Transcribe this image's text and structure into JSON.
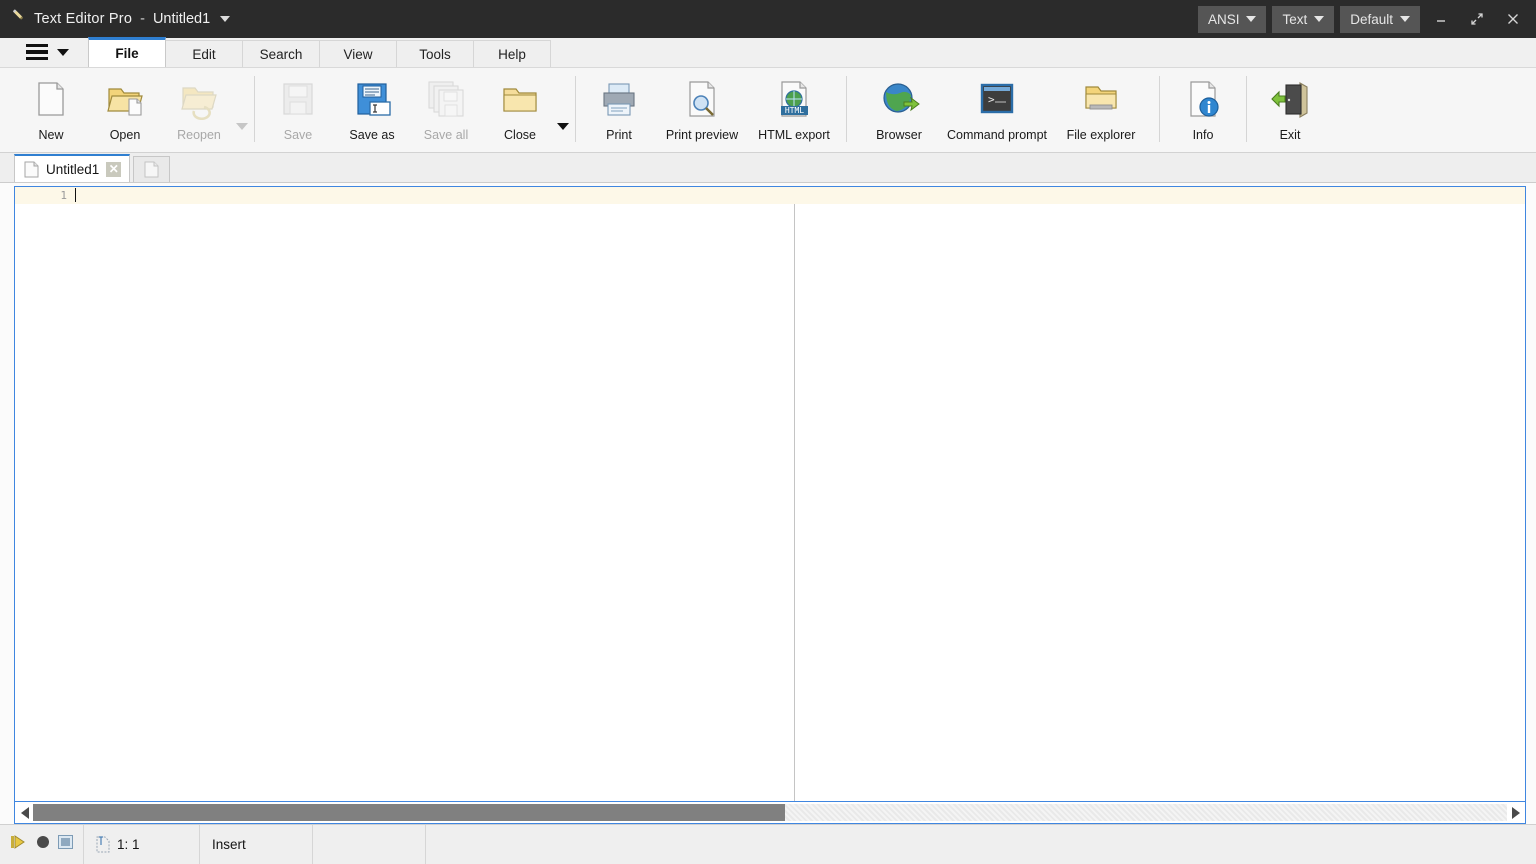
{
  "titlebar": {
    "app_icon": "pencil-icon",
    "app_name": "Text Editor Pro",
    "separator": "-",
    "document": "Untitled1",
    "doc_dropdown_icon": "chevron-down-icon",
    "pills": [
      {
        "label": "ANSI",
        "icon": "chevron-down-icon"
      },
      {
        "label": "Text",
        "icon": "chevron-down-icon"
      },
      {
        "label": "Default",
        "icon": "chevron-down-icon"
      }
    ],
    "window_controls": [
      {
        "name": "minimize-button",
        "icon": "minimize-icon"
      },
      {
        "name": "maximize-button",
        "icon": "maximize-icon"
      },
      {
        "name": "close-button",
        "icon": "close-icon"
      }
    ]
  },
  "menu": {
    "hamburger_icon": "hamburger-icon",
    "hamburger_caret_icon": "chevron-down-icon"
  },
  "ribbon_tabs": [
    {
      "label": "File",
      "active": true
    },
    {
      "label": "Edit",
      "active": false
    },
    {
      "label": "Search",
      "active": false
    },
    {
      "label": "View",
      "active": false
    },
    {
      "label": "Tools",
      "active": false
    },
    {
      "label": "Help",
      "active": false
    }
  ],
  "ribbon_buttons": {
    "new": {
      "label": "New",
      "icon": "new-document-icon",
      "enabled": true
    },
    "open": {
      "label": "Open",
      "icon": "open-folder-icon",
      "enabled": true
    },
    "reopen": {
      "label": "Reopen",
      "icon": "reopen-folder-icon",
      "enabled": false,
      "has_dropdown": true
    },
    "save": {
      "label": "Save",
      "icon": "floppy-disk-icon",
      "enabled": false
    },
    "save_as": {
      "label": "Save as",
      "icon": "floppy-disk-rename-icon",
      "enabled": true
    },
    "save_all": {
      "label": "Save all",
      "icon": "floppy-disk-stack-icon",
      "enabled": false
    },
    "close": {
      "label": "Close",
      "icon": "close-folder-icon",
      "enabled": true,
      "has_dropdown": true
    },
    "print": {
      "label": "Print",
      "icon": "printer-icon",
      "enabled": true
    },
    "print_preview": {
      "label": "Print preview",
      "icon": "print-preview-icon",
      "enabled": true
    },
    "html_export": {
      "label": "HTML export",
      "icon": "html-export-icon",
      "enabled": true
    },
    "browser": {
      "label": "Browser",
      "icon": "globe-icon",
      "enabled": true
    },
    "command_prompt": {
      "label": "Command prompt",
      "icon": "terminal-icon",
      "enabled": true
    },
    "file_explorer": {
      "label": "File explorer",
      "icon": "file-explorer-icon",
      "enabled": true
    },
    "info": {
      "label": "Info",
      "icon": "info-document-icon",
      "enabled": true
    },
    "exit": {
      "label": "Exit",
      "icon": "exit-door-icon",
      "enabled": true
    }
  },
  "document_tabs": {
    "active_tab": {
      "label": "Untitled1",
      "icon": "page-icon",
      "close_icon": "close-icon",
      "close_label": "✕"
    },
    "new_tab": {
      "icon": "page-icon"
    }
  },
  "editor": {
    "line_number": "1",
    "content": "",
    "current_line_highlight_color": "#fdf8e8",
    "border_color": "#3f86e0",
    "margin_guide_color": "#c4c4c4"
  },
  "scrollbar": {
    "left_arrow_icon": "arrow-left-icon",
    "right_arrow_icon": "arrow-right-icon"
  },
  "statusbar": {
    "icons": [
      {
        "name": "play-icon"
      },
      {
        "name": "record-icon"
      },
      {
        "name": "panel-icon"
      }
    ],
    "cursor_icon": "cursor-position-icon",
    "cursor_position": "1: 1",
    "insert_mode": "Insert",
    "cell4": "",
    "cell5": ""
  },
  "colors": {
    "titlebar_bg": "#2b2b2b",
    "pill_bg": "#555555",
    "accent_blue": "#2f7fd1",
    "ribbon_bg": "#f6f6f6",
    "status_bg": "#efefef"
  }
}
